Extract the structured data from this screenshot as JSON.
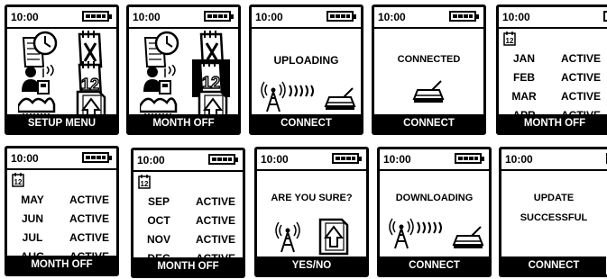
{
  "time": "10:00",
  "icons": {
    "clock_calendar": "calendar-clock-icon",
    "calendar_x": "calendar-x-icon",
    "person_signal": "person-transmitter-icon",
    "calendar_12": "calendar-12-icon",
    "hills": "terrain-icon",
    "upload_doc": "upload-document-icon",
    "tower": "radio-tower-icon",
    "base": "base-station-icon",
    "battery": "battery-icon"
  },
  "screens": [
    {
      "footer": "SETUP MENU"
    },
    {
      "footer": "MONTH OFF"
    },
    {
      "message": "UPLOADING",
      "footer": "CONNECT"
    },
    {
      "message": "CONNECTED",
      "footer": "CONNECT"
    },
    {
      "months": [
        {
          "month": "JAN",
          "status": "ACTIVE"
        },
        {
          "month": "FEB",
          "status": "ACTIVE"
        },
        {
          "month": "MAR",
          "status": "ACTIVE"
        },
        {
          "month": "APR",
          "status": "ACTIVE"
        }
      ],
      "footer": "MONTH OFF"
    },
    {
      "months": [
        {
          "month": "MAY",
          "status": "ACTIVE"
        },
        {
          "month": "JUN",
          "status": "ACTIVE"
        },
        {
          "month": "JUL",
          "status": "ACTIVE"
        },
        {
          "month": "AUG",
          "status": "ACTIVE"
        }
      ],
      "footer": "MONTH OFF"
    },
    {
      "months": [
        {
          "month": "SEP",
          "status": "ACTIVE"
        },
        {
          "month": "OCT",
          "status": "ACTIVE"
        },
        {
          "month": "NOV",
          "status": "ACTIVE"
        },
        {
          "month": "DEC",
          "status": "ACTIVE"
        }
      ],
      "footer": "MONTH OFF"
    },
    {
      "message": "ARE YOU SURE?",
      "footer": "YES/NO"
    },
    {
      "message": "DOWNLOADING",
      "footer": "CONNECT"
    },
    {
      "message_line1": "UPDATE",
      "message_line2": "SUCCESSFUL",
      "footer": "CONNECT"
    }
  ]
}
